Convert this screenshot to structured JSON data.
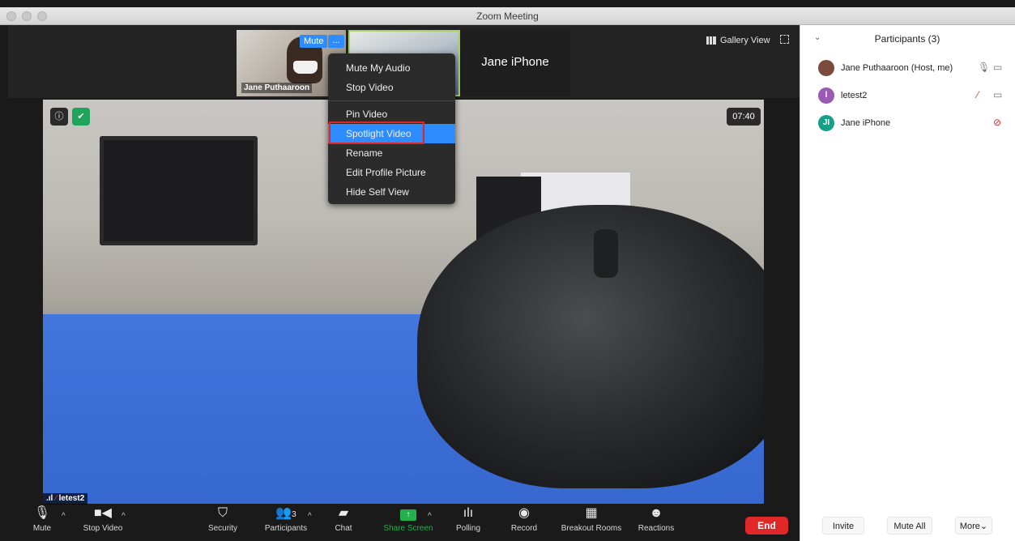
{
  "window": {
    "title": "Zoom Meeting"
  },
  "thumbnails": [
    {
      "name": "Jane Puthaaroon",
      "mute_label": "Mute",
      "more_label": "..."
    },
    {
      "name": ""
    },
    {
      "name": "Jane iPhone"
    }
  ],
  "top_controls": {
    "gallery_view": "Gallery View"
  },
  "context_menu": {
    "items": [
      "Mute My Audio",
      "Stop Video",
      "Pin Video",
      "Spotlight Video",
      "Rename",
      "Edit Profile Picture",
      "Hide Self View"
    ],
    "selected": "Spotlight Video"
  },
  "video": {
    "timer": "07:40",
    "speaker_name": "letest2",
    "info_icon": "info-icon",
    "security_icon": "shield-check-icon"
  },
  "toolbar": {
    "mute": "Mute",
    "stop_video": "Stop Video",
    "security": "Security",
    "participants": "Participants",
    "participants_count": "3",
    "chat": "Chat",
    "share_screen": "Share Screen",
    "polling": "Polling",
    "record": "Record",
    "breakout_rooms": "Breakout Rooms",
    "reactions": "Reactions",
    "end": "End"
  },
  "participants_panel": {
    "title": "Participants (3)",
    "participants": [
      {
        "name": "Jane Puthaaroon (Host, me)",
        "avatar": "",
        "avatar_color": "#7a4a3a",
        "mic": "mic-on-icon",
        "video": "video-on-icon"
      },
      {
        "name": "letest2",
        "avatar": "l",
        "avatar_color": "#9b59b6",
        "mic": "mic-muted-icon",
        "video": "video-on-icon"
      },
      {
        "name": "Jane iPhone",
        "avatar": "JI",
        "avatar_color": "#16a085",
        "mic": "",
        "video": "video-off-icon"
      }
    ],
    "footer": {
      "invite": "Invite",
      "mute_all": "Mute All",
      "more": "More"
    }
  },
  "colors": {
    "accent": "#2d8cff",
    "end": "#e02828",
    "share_green": "#22b14c",
    "highlight_red": "#e0242a"
  }
}
